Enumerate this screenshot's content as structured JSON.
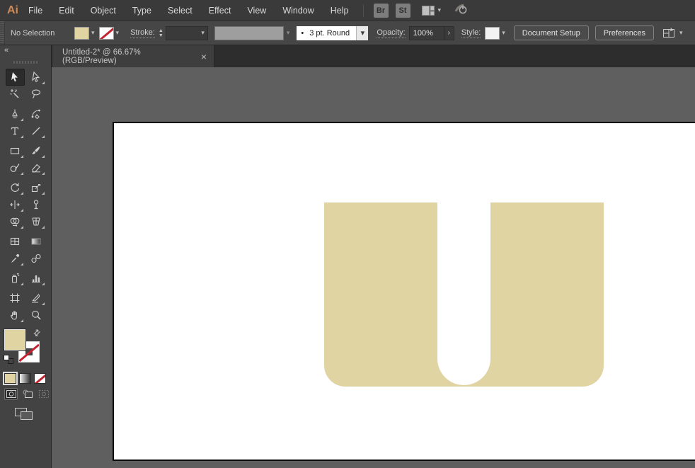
{
  "app": {
    "logo": "Ai"
  },
  "menu_bar": {
    "items": [
      "File",
      "Edit",
      "Object",
      "Type",
      "Select",
      "Effect",
      "View",
      "Window",
      "Help"
    ],
    "bridge_label": "Br",
    "stock_label": "St"
  },
  "control_bar": {
    "selection_status": "No Selection",
    "fill_swatch_color": "#e0d5a2",
    "stroke_swatch": "none",
    "stroke_label": "Stroke:",
    "brush_bullet": "•",
    "brush_value": "3 pt. Round",
    "opacity_label": "Opacity:",
    "opacity_value": "100%",
    "opacity_more_glyph": "›",
    "style_label": "Style:",
    "document_setup_label": "Document Setup",
    "preferences_label": "Preferences"
  },
  "document_tab": {
    "title": "Untitled-2* @ 66.67% (RGB/Preview)",
    "close_glyph": "×"
  },
  "icons": {
    "chevron_down": "▾",
    "stepper_up": "▲",
    "stepper_down": "▼",
    "collapse": "«",
    "swap": "⇄"
  },
  "toolbar": {
    "tools": [
      {
        "name": "selection",
        "active": true,
        "flyout": false
      },
      {
        "name": "direct-selection",
        "flyout": true
      },
      {
        "name": "magic-wand",
        "flyout": false
      },
      {
        "name": "lasso",
        "flyout": false,
        "group_after": true
      },
      {
        "name": "pen",
        "flyout": true
      },
      {
        "name": "curvature",
        "flyout": false
      },
      {
        "name": "type",
        "flyout": true
      },
      {
        "name": "line-segment",
        "flyout": true,
        "group_after": true
      },
      {
        "name": "rectangle",
        "flyout": true
      },
      {
        "name": "paintbrush",
        "flyout": true
      },
      {
        "name": "shaper",
        "flyout": true
      },
      {
        "name": "eraser",
        "flyout": true,
        "group_after": true
      },
      {
        "name": "rotate",
        "flyout": true
      },
      {
        "name": "scale",
        "flyout": true
      },
      {
        "name": "width",
        "flyout": true
      },
      {
        "name": "puppet-warp",
        "flyout": false
      },
      {
        "name": "shape-builder",
        "flyout": true
      },
      {
        "name": "perspective-grid",
        "flyout": true,
        "group_after": true
      },
      {
        "name": "mesh",
        "flyout": false
      },
      {
        "name": "gradient",
        "flyout": false
      },
      {
        "name": "eyedropper",
        "flyout": true
      },
      {
        "name": "blend",
        "flyout": false,
        "group_after": true
      },
      {
        "name": "symbol-sprayer",
        "flyout": true
      },
      {
        "name": "column-graph",
        "flyout": true,
        "group_after": true
      },
      {
        "name": "artboard",
        "flyout": false
      },
      {
        "name": "slice",
        "flyout": true
      },
      {
        "name": "hand",
        "flyout": true
      },
      {
        "name": "zoom",
        "flyout": false
      }
    ]
  },
  "canvas": {
    "shape": "letter-U",
    "shape_fill": "#e0d5a2",
    "artboard_color": "#ffffff",
    "pasteboard_color": "#5f5f5f"
  }
}
